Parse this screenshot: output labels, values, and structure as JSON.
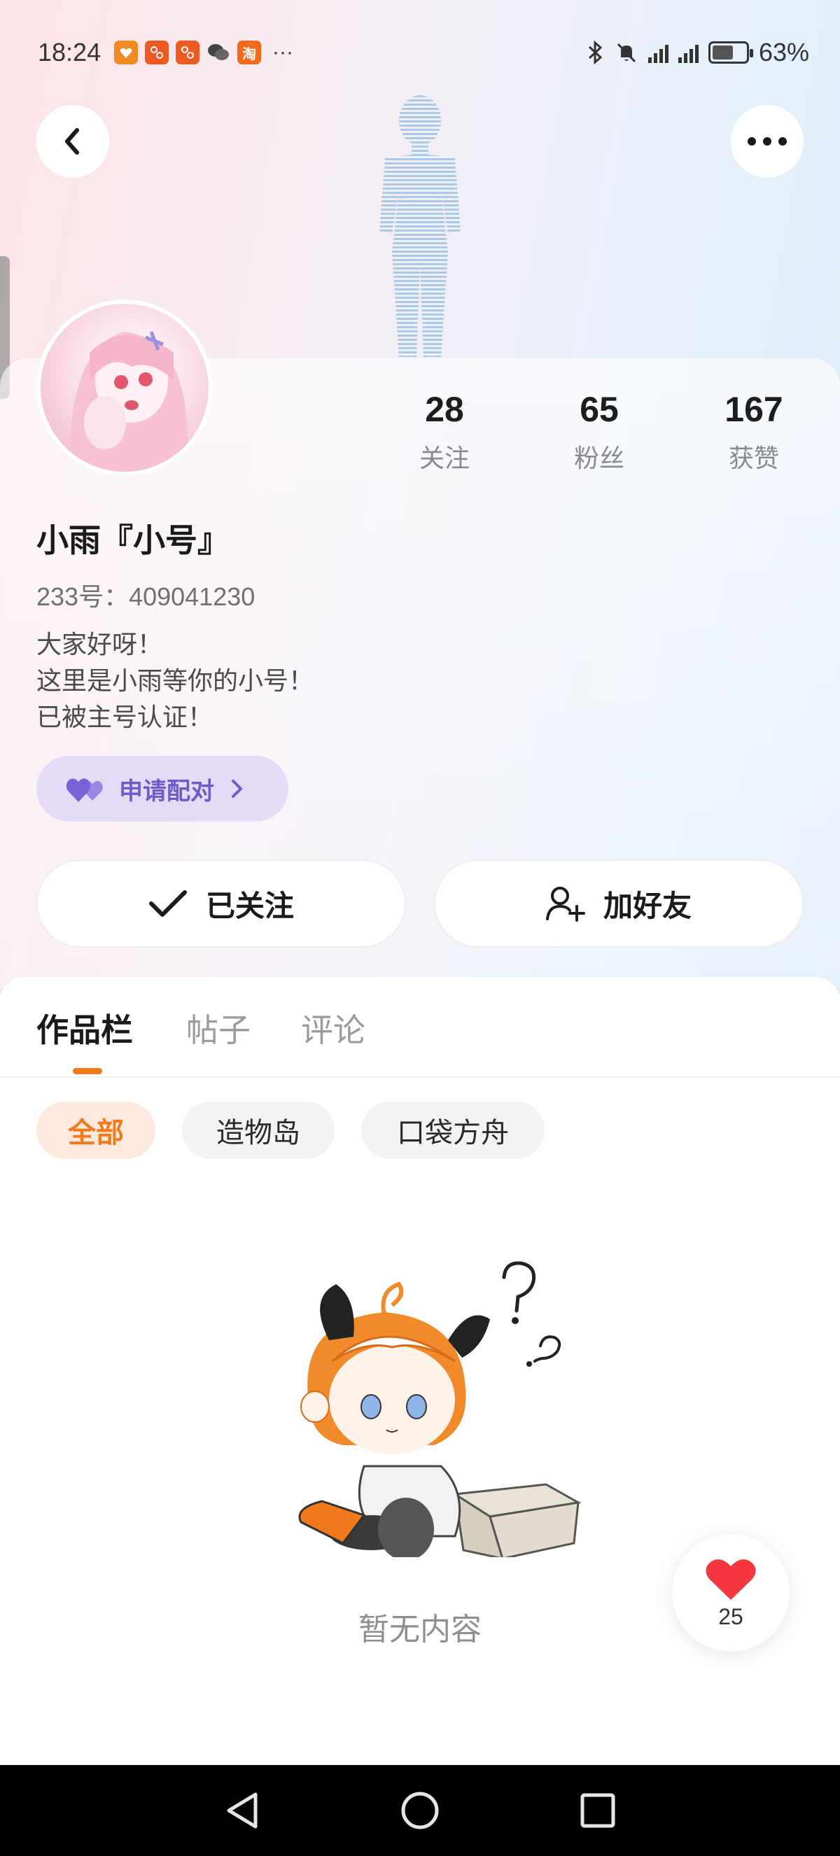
{
  "status_bar": {
    "time": "18:24",
    "apps": [
      "taobao-icon",
      "app-icon-1",
      "app-icon-2",
      "wechat-icon",
      "taobao-tao-icon"
    ],
    "app_glyphs": [
      "",
      "",
      "",
      "",
      "淘"
    ],
    "more": "···",
    "battery": "63%",
    "battery_level": 0.63
  },
  "header": {
    "back_icon": "chevron-left-icon",
    "more_icon": "more-dots-icon"
  },
  "profile": {
    "nickname": "小雨『小号』",
    "uid": "233号：409041230",
    "bio_lines": [
      "大家好呀！",
      "这里是小雨等你的小号！",
      "已被主号认证！"
    ],
    "stats": [
      {
        "value": "28",
        "label": "关注"
      },
      {
        "value": "65",
        "label": "粉丝"
      },
      {
        "value": "167",
        "label": "获赞"
      }
    ],
    "pair_button": "申请配对"
  },
  "actions": {
    "follow": "已关注",
    "add_friend": "加好友"
  },
  "tabs": [
    {
      "label": "作品栏",
      "active": true
    },
    {
      "label": "帖子",
      "active": false
    },
    {
      "label": "评论",
      "active": false
    }
  ],
  "filters": [
    {
      "label": "全部",
      "active": true
    },
    {
      "label": "造物岛",
      "active": false
    },
    {
      "label": "口袋方舟",
      "active": false
    }
  ],
  "empty_state": {
    "text": "暂无内容"
  },
  "like_fab": {
    "count": "25"
  },
  "colors": {
    "accent": "#f07a1c",
    "pair_purple": "#6e5bc7",
    "heart_red": "#f5383f"
  }
}
